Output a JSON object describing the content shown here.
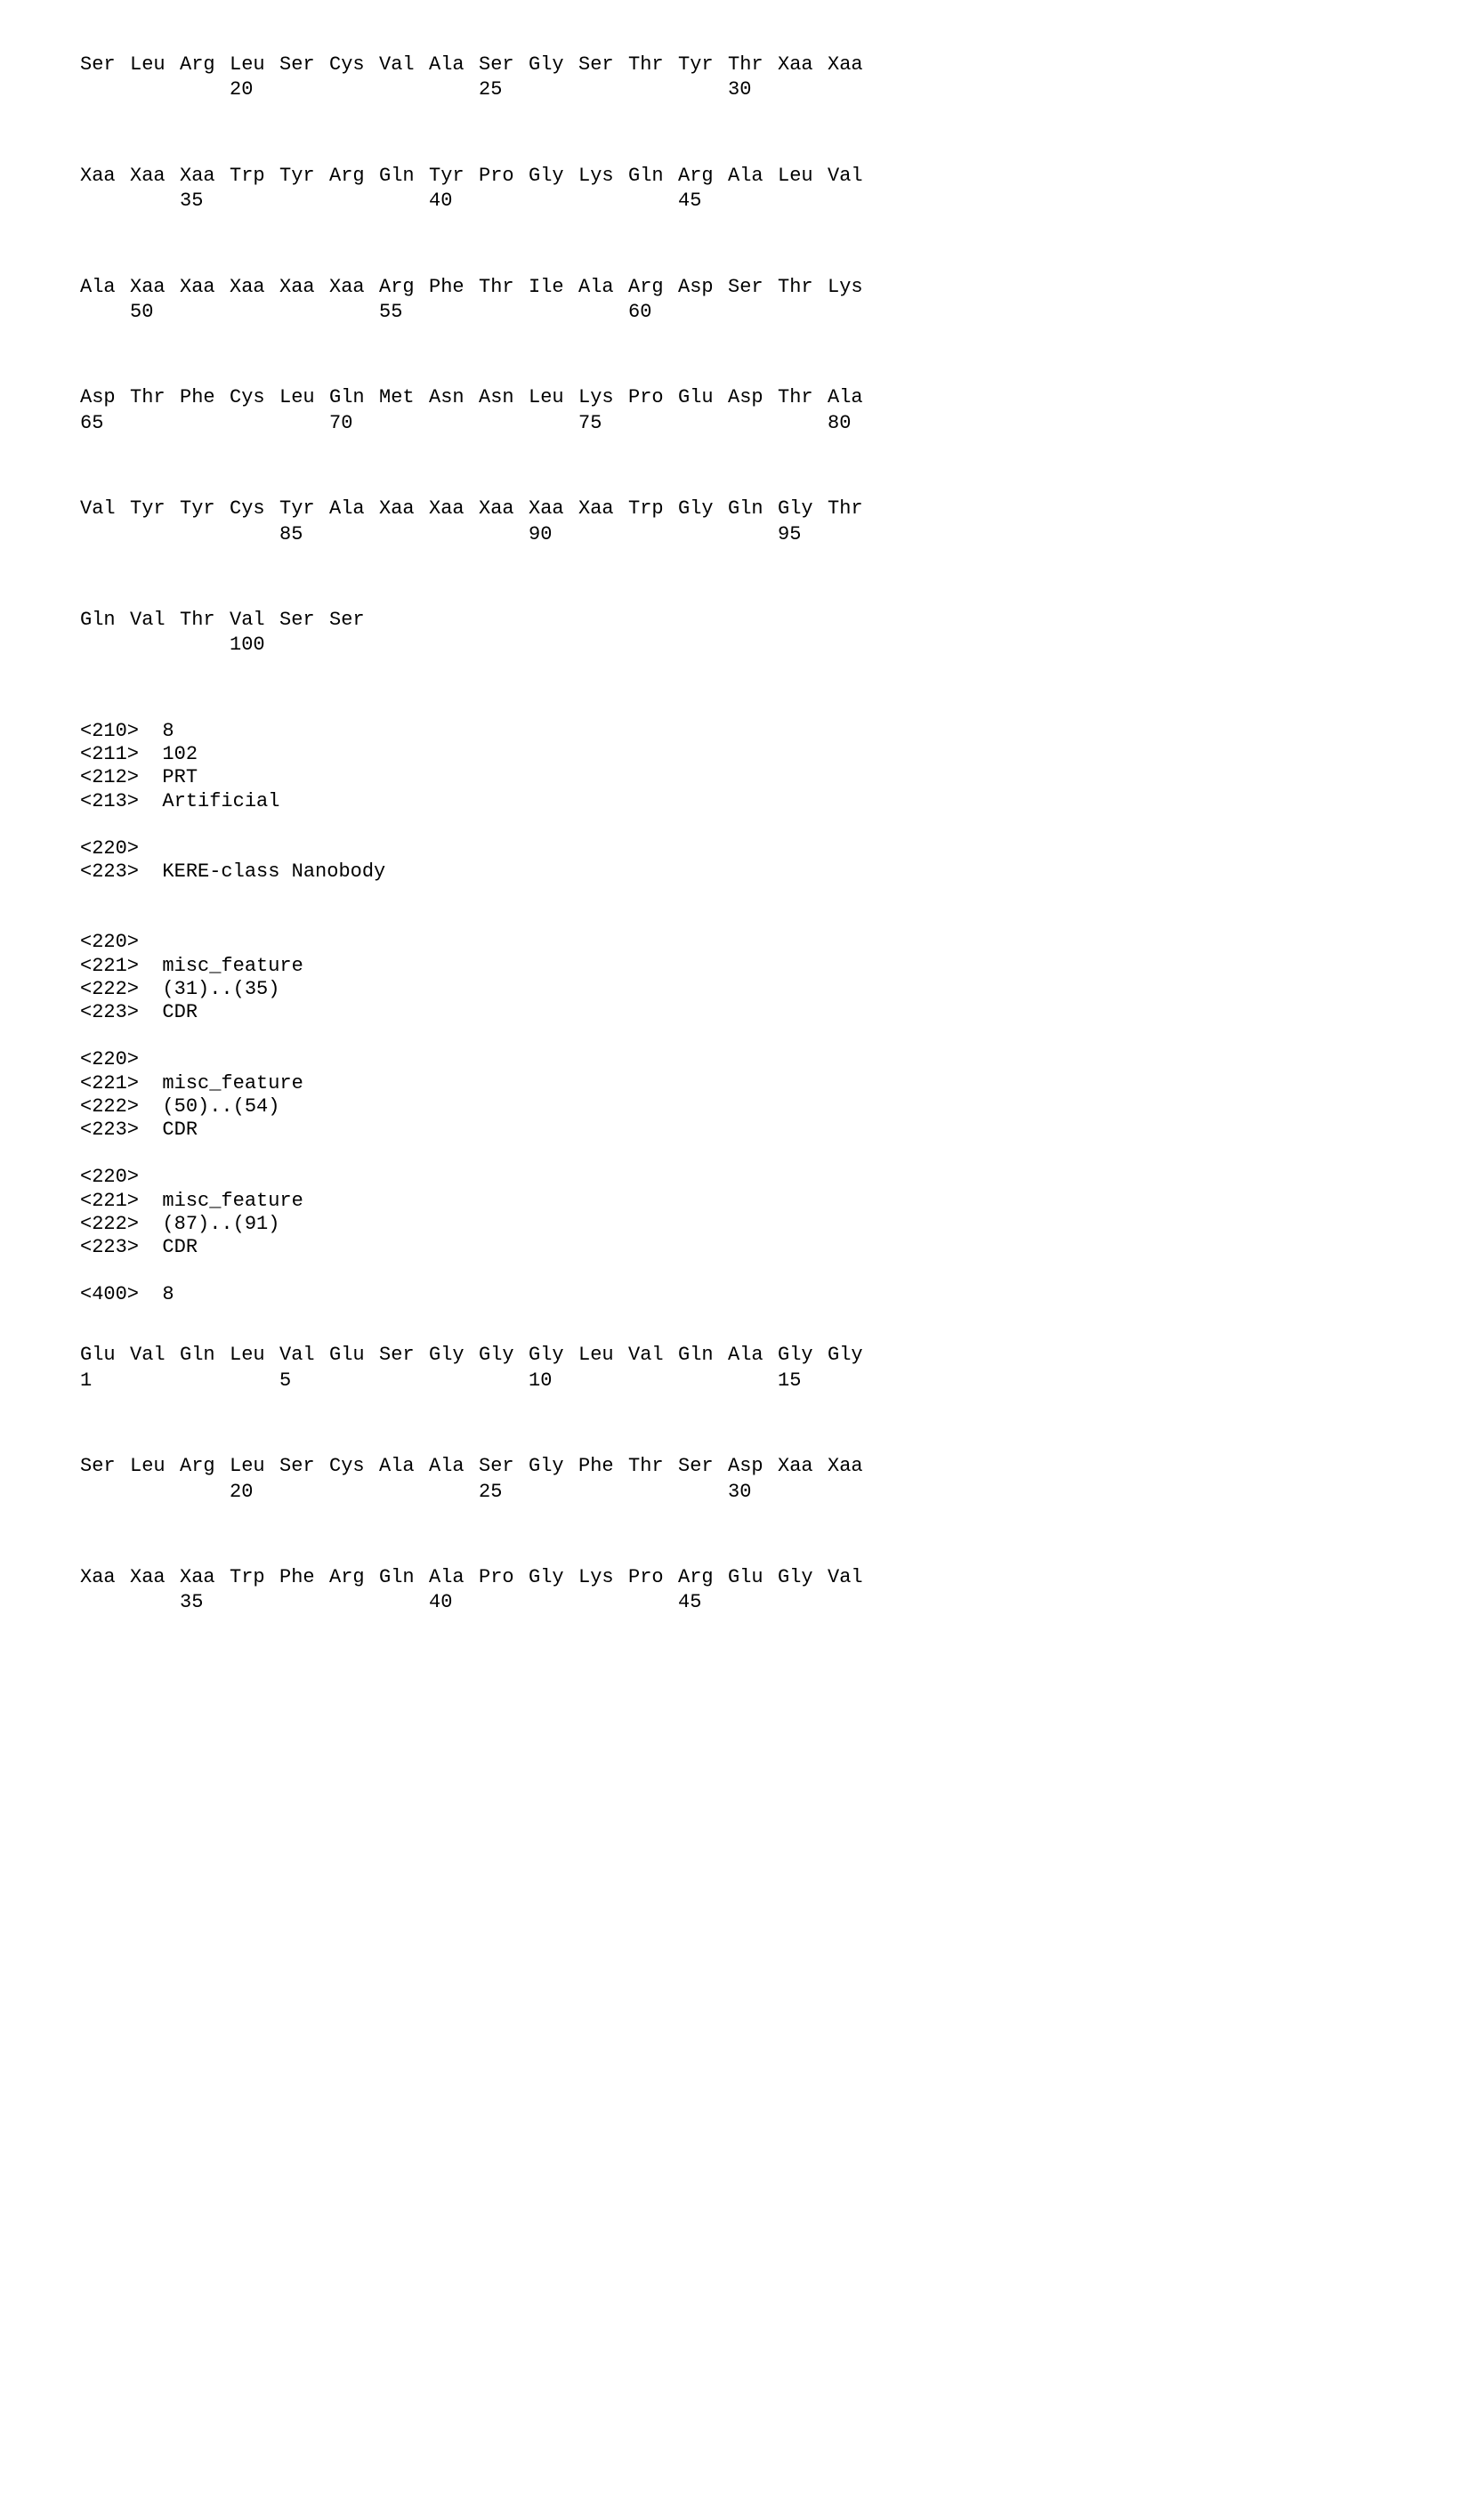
{
  "sequence1": {
    "rows": [
      {
        "residues": [
          "Ser",
          "Leu",
          "Arg",
          "Leu",
          "Ser",
          "Cys",
          "Val",
          "Ala",
          "Ser",
          "Gly",
          "Ser",
          "Thr",
          "Tyr",
          "Thr",
          "Xaa",
          "Xaa"
        ],
        "positions": [
          "",
          "",
          "",
          "20",
          "",
          "",
          "",
          "",
          "25",
          "",
          "",
          "",
          "",
          "30",
          "",
          ""
        ]
      },
      {
        "residues": [
          "Xaa",
          "Xaa",
          "Xaa",
          "Trp",
          "Tyr",
          "Arg",
          "Gln",
          "Tyr",
          "Pro",
          "Gly",
          "Lys",
          "Gln",
          "Arg",
          "Ala",
          "Leu",
          "Val"
        ],
        "positions": [
          "",
          "",
          "35",
          "",
          "",
          "",
          "",
          "40",
          "",
          "",
          "",
          "",
          "45",
          "",
          "",
          ""
        ]
      },
      {
        "residues": [
          "Ala",
          "Xaa",
          "Xaa",
          "Xaa",
          "Xaa",
          "Xaa",
          "Arg",
          "Phe",
          "Thr",
          "Ile",
          "Ala",
          "Arg",
          "Asp",
          "Ser",
          "Thr",
          "Lys"
        ],
        "positions": [
          "",
          "50",
          "",
          "",
          "",
          "",
          "55",
          "",
          "",
          "",
          "",
          "60",
          "",
          "",
          "",
          ""
        ]
      },
      {
        "residues": [
          "Asp",
          "Thr",
          "Phe",
          "Cys",
          "Leu",
          "Gln",
          "Met",
          "Asn",
          "Asn",
          "Leu",
          "Lys",
          "Pro",
          "Glu",
          "Asp",
          "Thr",
          "Ala"
        ],
        "positions": [
          "65",
          "",
          "",
          "",
          "",
          "70",
          "",
          "",
          "",
          "",
          "75",
          "",
          "",
          "",
          "",
          "80"
        ]
      },
      {
        "residues": [
          "Val",
          "Tyr",
          "Tyr",
          "Cys",
          "Tyr",
          "Ala",
          "Xaa",
          "Xaa",
          "Xaa",
          "Xaa",
          "Xaa",
          "Trp",
          "Gly",
          "Gln",
          "Gly",
          "Thr"
        ],
        "positions": [
          "",
          "",
          "",
          "",
          "85",
          "",
          "",
          "",
          "",
          "90",
          "",
          "",
          "",
          "",
          "95",
          ""
        ]
      },
      {
        "residues": [
          "Gln",
          "Val",
          "Thr",
          "Val",
          "Ser",
          "Ser"
        ],
        "positions": [
          "",
          "",
          "",
          "100",
          "",
          ""
        ]
      }
    ]
  },
  "meta": {
    "lines": [
      "<210>  8",
      "<211>  102",
      "<212>  PRT",
      "<213>  Artificial",
      "",
      "<220>",
      "<223>  KERE-class Nanobody",
      "",
      "",
      "<220>",
      "<221>  misc_feature",
      "<222>  (31)..(35)",
      "<223>  CDR",
      "",
      "<220>",
      "<221>  misc_feature",
      "<222>  (50)..(54)",
      "<223>  CDR",
      "",
      "<220>",
      "<221>  misc_feature",
      "<222>  (87)..(91)",
      "<223>  CDR",
      "",
      "<400>  8"
    ]
  },
  "sequence2": {
    "rows": [
      {
        "residues": [
          "Glu",
          "Val",
          "Gln",
          "Leu",
          "Val",
          "Glu",
          "Ser",
          "Gly",
          "Gly",
          "Gly",
          "Leu",
          "Val",
          "Gln",
          "Ala",
          "Gly",
          "Gly"
        ],
        "positions": [
          "1",
          "",
          "",
          "",
          "5",
          "",
          "",
          "",
          "",
          "10",
          "",
          "",
          "",
          "",
          "15",
          ""
        ]
      },
      {
        "residues": [
          "Ser",
          "Leu",
          "Arg",
          "Leu",
          "Ser",
          "Cys",
          "Ala",
          "Ala",
          "Ser",
          "Gly",
          "Phe",
          "Thr",
          "Ser",
          "Asp",
          "Xaa",
          "Xaa"
        ],
        "positions": [
          "",
          "",
          "",
          "20",
          "",
          "",
          "",
          "",
          "25",
          "",
          "",
          "",
          "",
          "30",
          "",
          ""
        ]
      },
      {
        "residues": [
          "Xaa",
          "Xaa",
          "Xaa",
          "Trp",
          "Phe",
          "Arg",
          "Gln",
          "Ala",
          "Pro",
          "Gly",
          "Lys",
          "Pro",
          "Arg",
          "Glu",
          "Gly",
          "Val"
        ],
        "positions": [
          "",
          "",
          "35",
          "",
          "",
          "",
          "",
          "40",
          "",
          "",
          "",
          "",
          "45",
          "",
          "",
          ""
        ]
      }
    ]
  }
}
